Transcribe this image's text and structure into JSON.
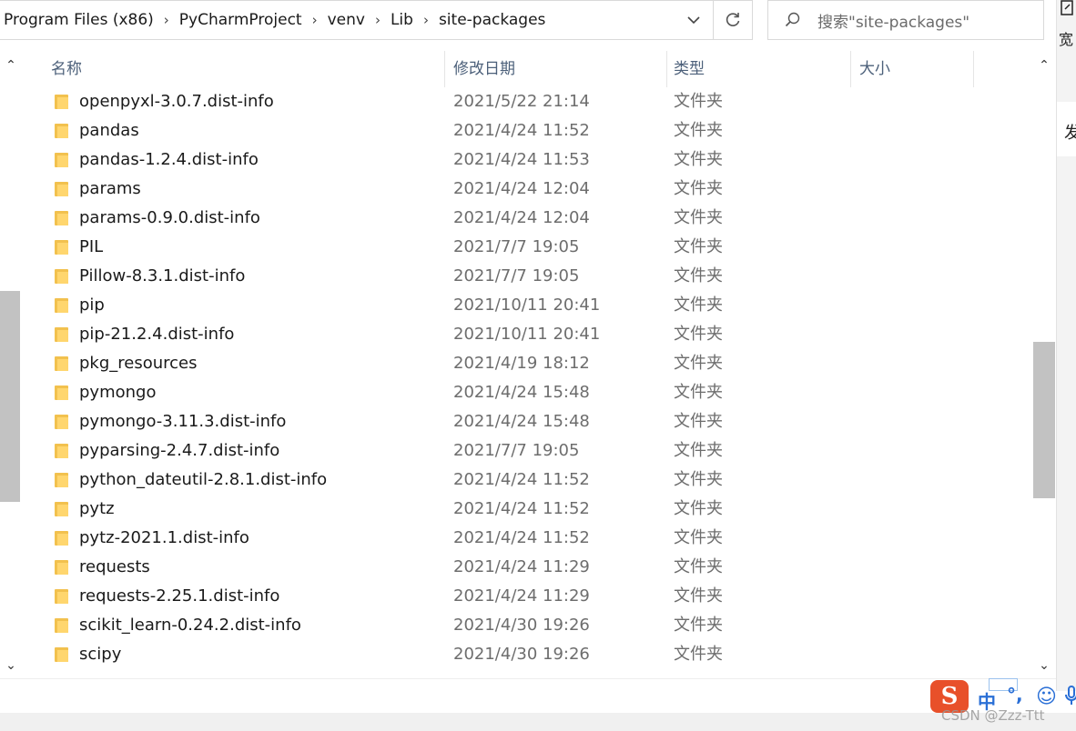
{
  "address": {
    "crumbs": [
      "Program Files (x86)",
      "PyCharmProject",
      "venv",
      "Lib",
      "site-packages"
    ]
  },
  "search": {
    "placeholder": "搜索\"site-packages\""
  },
  "side": {
    "text_1": "宽",
    "text_2": "发"
  },
  "columns": {
    "name": "名称",
    "date": "修改日期",
    "type": "类型",
    "size": "大小"
  },
  "rows": [
    {
      "name": "openpyxl-3.0.7.dist-info",
      "date": "2021/5/22 21:14",
      "type": "文件夹"
    },
    {
      "name": "pandas",
      "date": "2021/4/24 11:52",
      "type": "文件夹"
    },
    {
      "name": "pandas-1.2.4.dist-info",
      "date": "2021/4/24 11:53",
      "type": "文件夹"
    },
    {
      "name": "params",
      "date": "2021/4/24 12:04",
      "type": "文件夹"
    },
    {
      "name": "params-0.9.0.dist-info",
      "date": "2021/4/24 12:04",
      "type": "文件夹"
    },
    {
      "name": "PIL",
      "date": "2021/7/7 19:05",
      "type": "文件夹"
    },
    {
      "name": "Pillow-8.3.1.dist-info",
      "date": "2021/7/7 19:05",
      "type": "文件夹"
    },
    {
      "name": "pip",
      "date": "2021/10/11 20:41",
      "type": "文件夹"
    },
    {
      "name": "pip-21.2.4.dist-info",
      "date": "2021/10/11 20:41",
      "type": "文件夹"
    },
    {
      "name": "pkg_resources",
      "date": "2021/4/19 18:12",
      "type": "文件夹"
    },
    {
      "name": "pymongo",
      "date": "2021/4/24 15:48",
      "type": "文件夹"
    },
    {
      "name": "pymongo-3.11.3.dist-info",
      "date": "2021/4/24 15:48",
      "type": "文件夹"
    },
    {
      "name": "pyparsing-2.4.7.dist-info",
      "date": "2021/7/7 19:05",
      "type": "文件夹"
    },
    {
      "name": "python_dateutil-2.8.1.dist-info",
      "date": "2021/4/24 11:52",
      "type": "文件夹"
    },
    {
      "name": "pytz",
      "date": "2021/4/24 11:52",
      "type": "文件夹"
    },
    {
      "name": "pytz-2021.1.dist-info",
      "date": "2021/4/24 11:52",
      "type": "文件夹"
    },
    {
      "name": "requests",
      "date": "2021/4/24 11:29",
      "type": "文件夹"
    },
    {
      "name": "requests-2.25.1.dist-info",
      "date": "2021/4/24 11:29",
      "type": "文件夹"
    },
    {
      "name": "scikit_learn-0.24.2.dist-info",
      "date": "2021/4/30 19:26",
      "type": "文件夹"
    },
    {
      "name": "scipy",
      "date": "2021/4/30 19:26",
      "type": "文件夹"
    }
  ],
  "ime": {
    "logo": "S",
    "mode": "中",
    "punct": "°,",
    "smile": "☺",
    "mic": "🎤"
  },
  "watermark": "CSDN @Zzz-Ttt",
  "colors": {
    "folder": "#ffd66e",
    "header_text": "#4c607a",
    "ime_accent": "#2a6fd6",
    "ime_logo": "#e8502a"
  },
  "icons": {
    "search": "search-icon",
    "refresh": "refresh-icon",
    "dropdown": "chevron-down-icon",
    "folder": "folder-icon"
  }
}
